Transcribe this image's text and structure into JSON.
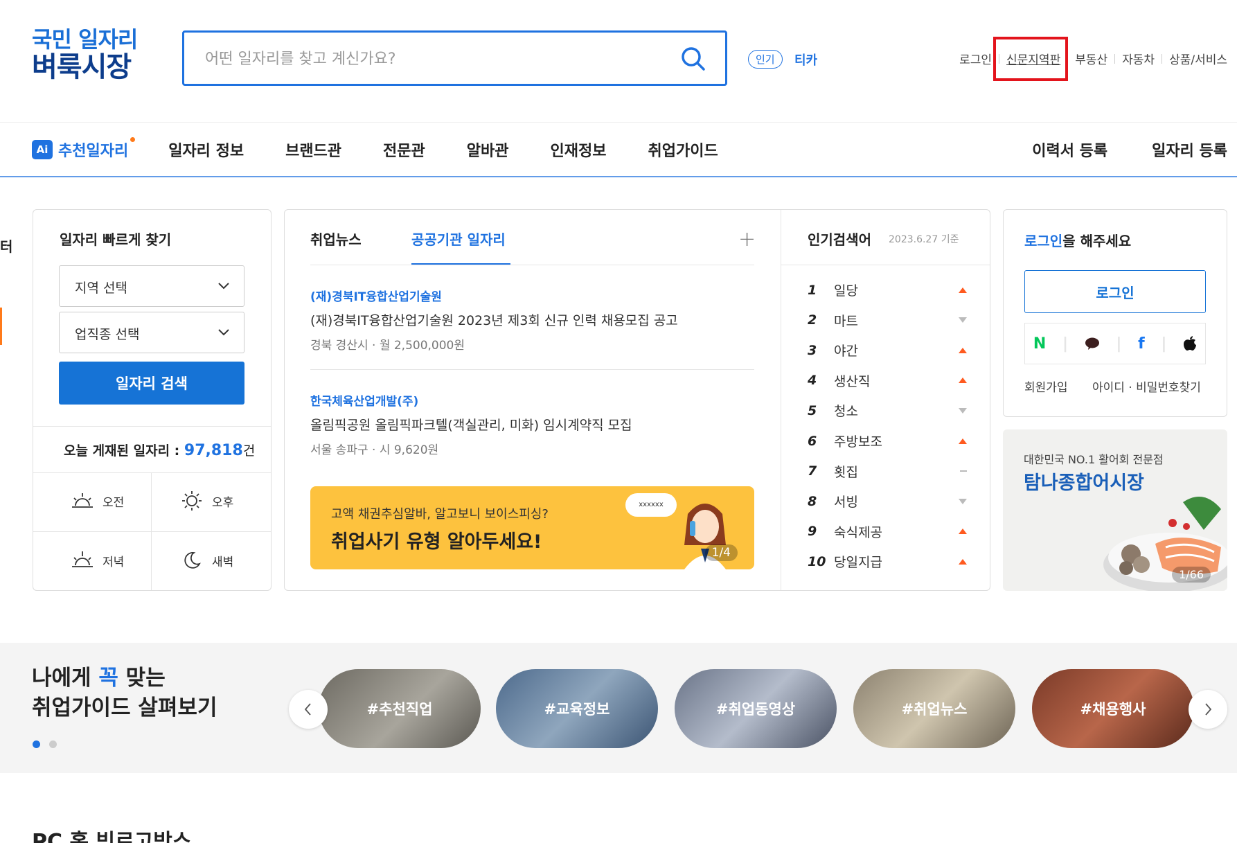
{
  "header": {
    "logo_line1": "국민 일자리",
    "logo_line2": "벼룩시장",
    "search_placeholder": "어떤 일자리를 찾고 계신가요?",
    "hot_badge": "인기",
    "hot_word": "티카",
    "top_links": [
      "로그인",
      "신문지역판",
      "부동산",
      "자동차",
      "상품/서비스"
    ]
  },
  "nav": {
    "ai_badge": "Ai",
    "ai_label": "추천일자리",
    "items": [
      "일자리 정보",
      "브랜드관",
      "전문관",
      "알바관",
      "인재정보",
      "취업가이드"
    ],
    "right": [
      "이력서 등록",
      "일자리 등록"
    ]
  },
  "quick_find": {
    "title": "일자리 빠르게 찾기",
    "region": "지역 선택",
    "job_type": "업직종 선택",
    "search_button": "일자리 검색",
    "today_label": "오늘 게재된 일자리 : ",
    "today_count": "97,818",
    "today_unit": "건",
    "times": [
      "오전",
      "오후",
      "저녁",
      "새벽"
    ]
  },
  "news": {
    "tabs": [
      "취업뉴스",
      "공공기관 일자리"
    ],
    "plus": "+",
    "items": [
      {
        "org": "(재)경북IT융합산업기술원",
        "title": "(재)경북IT융합산업기술원 2023년 제3회 신규 인력 채용모집 공고",
        "meta": "경북 경산시  · 월 2,500,000원"
      },
      {
        "org": "한국체육산업개발(주)",
        "title": "올림픽공원 올림픽파크텔(객실관리, 미화) 임시계약직 모집",
        "meta": "서울 송파구  · 시 9,620원"
      }
    ],
    "banner": {
      "line1": "고액 채권추심알바, 알고보니 보이스피싱?",
      "line2": "취업사기 유형 알아두세요!",
      "bubble": "xxxxxx",
      "page": "1/4"
    }
  },
  "popular": {
    "title": "인기검색어",
    "date": "2023.6.27 기준",
    "items": [
      {
        "rank": "1",
        "word": "일당",
        "trend": "up"
      },
      {
        "rank": "2",
        "word": "마트",
        "trend": "down"
      },
      {
        "rank": "3",
        "word": "야간",
        "trend": "up"
      },
      {
        "rank": "4",
        "word": "생산직",
        "trend": "up"
      },
      {
        "rank": "5",
        "word": "청소",
        "trend": "down"
      },
      {
        "rank": "6",
        "word": "주방보조",
        "trend": "up"
      },
      {
        "rank": "7",
        "word": "횟집",
        "trend": "same"
      },
      {
        "rank": "8",
        "word": "서빙",
        "trend": "down"
      },
      {
        "rank": "9",
        "word": "숙식제공",
        "trend": "up"
      },
      {
        "rank": "10",
        "word": "당일지급",
        "trend": "up"
      }
    ]
  },
  "login_box": {
    "title_highlight": "로그인",
    "title_rest": "을 해주세요",
    "button": "로그인",
    "social": [
      "N",
      "talk",
      "f",
      "apple"
    ],
    "signup": "회원가입",
    "find": "아이디 · 비밀번호찾기"
  },
  "ad": {
    "line1": "대한민국 NO.1 활어회 전문점",
    "line2": "탐나종합어시장",
    "page": "1/66"
  },
  "guide": {
    "title_pre": "나에게 ",
    "title_hl": "꼭",
    "title_post": " 맞는",
    "title_line2": "취업가이드 살펴보기",
    "pills": [
      "#추천직업",
      "#교육정보",
      "#취업동영상",
      "#취업뉴스",
      "#채용행사"
    ]
  },
  "bottom_title": "PC 홈 빅로고박스",
  "edge_text": "터",
  "colors": {
    "brand": "#1f72e0",
    "highlight_box": "#e3141c",
    "banner": "#fdc23e"
  }
}
